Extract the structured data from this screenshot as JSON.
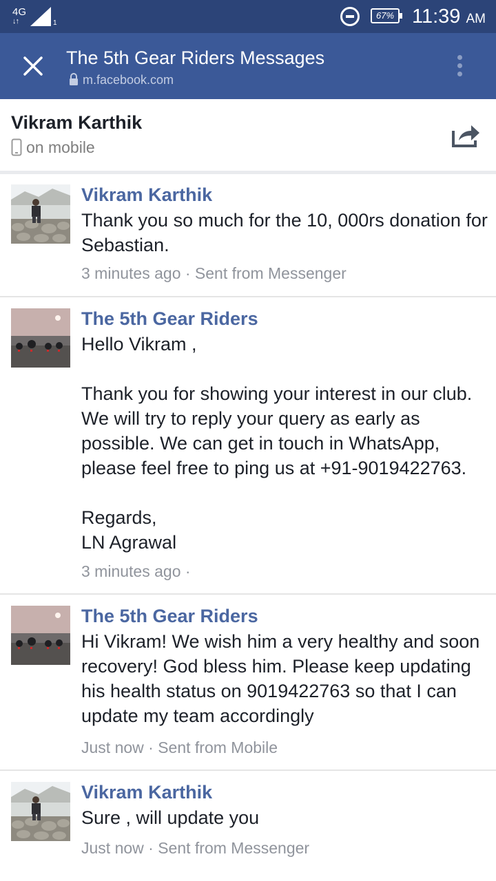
{
  "status_bar": {
    "network": "4G",
    "network_arrows": "↓↑",
    "signal_sub": "1",
    "battery": "67%",
    "time": "11:39",
    "ampm": "AM"
  },
  "app_bar": {
    "title": "The 5th Gear Riders Messages",
    "url": "m.facebook.com"
  },
  "conversation": {
    "name": "Vikram Karthik",
    "status": "on mobile"
  },
  "messages": [
    {
      "author": "Vikram Karthik",
      "lines": [
        "Thank you so much for the 10, 000rs donation for Sebastian."
      ],
      "meta": "3 minutes ago · Sent from Messenger"
    },
    {
      "author": "The 5th Gear Riders",
      "lines": [
        "Hello Vikram ,",
        "",
        "Thank you for showing your interest in our club. We will try to reply your query as early as possible. We can get in touch in WhatsApp, please feel free to ping us at +91-9019422763.",
        "",
        "Regards,",
        "LN Agrawal"
      ],
      "meta": "3 minutes ago ·"
    },
    {
      "author": "The 5th Gear Riders",
      "lines": [
        "Hi Vikram! We wish him a very healthy and soon recovery! God bless him. Please keep updating his health status on 9019422763 so that I can update my team accordingly"
      ],
      "meta": "Just now · Sent from Mobile"
    },
    {
      "author": "Vikram Karthik",
      "lines": [
        "Sure , will update you"
      ],
      "meta": "Just now · Sent from Messenger"
    }
  ],
  "icons": {
    "close": "close-icon",
    "lock": "lock-icon",
    "more": "more-vertical-icon",
    "phone": "phone-icon",
    "share": "share-icon",
    "dnd": "do-not-disturb-icon",
    "battery": "battery-icon",
    "signal": "signal-icon"
  },
  "colors": {
    "status_bar": "#2c4478",
    "app_bar": "#3b5998",
    "author_link": "#4b67a1",
    "meta_text": "#90949c",
    "divider": "#e5e5e5"
  }
}
